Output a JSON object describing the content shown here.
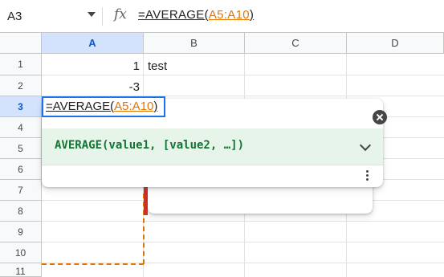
{
  "formula_bar": {
    "name_box": "A3",
    "fx_label": "fx",
    "formula_prefix": "=AVERAGE(",
    "formula_range": "A5:A10",
    "formula_suffix": ")"
  },
  "columns": [
    "A",
    "B",
    "C",
    "D"
  ],
  "rows": [
    "1",
    "2",
    "3",
    "4",
    "5",
    "6",
    "7",
    "8",
    "9",
    "10",
    "11"
  ],
  "cells": {
    "A1": "1",
    "B1": "test",
    "A2": "-3"
  },
  "editor": {
    "prefix": "=AVERAGE(",
    "range": "A5:A10",
    "suffix": ")"
  },
  "formula_help": {
    "signature": "AVERAGE(value1, [value2, …])"
  },
  "colors": {
    "selection_blue": "#1a73e8",
    "range_orange": "#e37400",
    "help_green": "#137333"
  }
}
